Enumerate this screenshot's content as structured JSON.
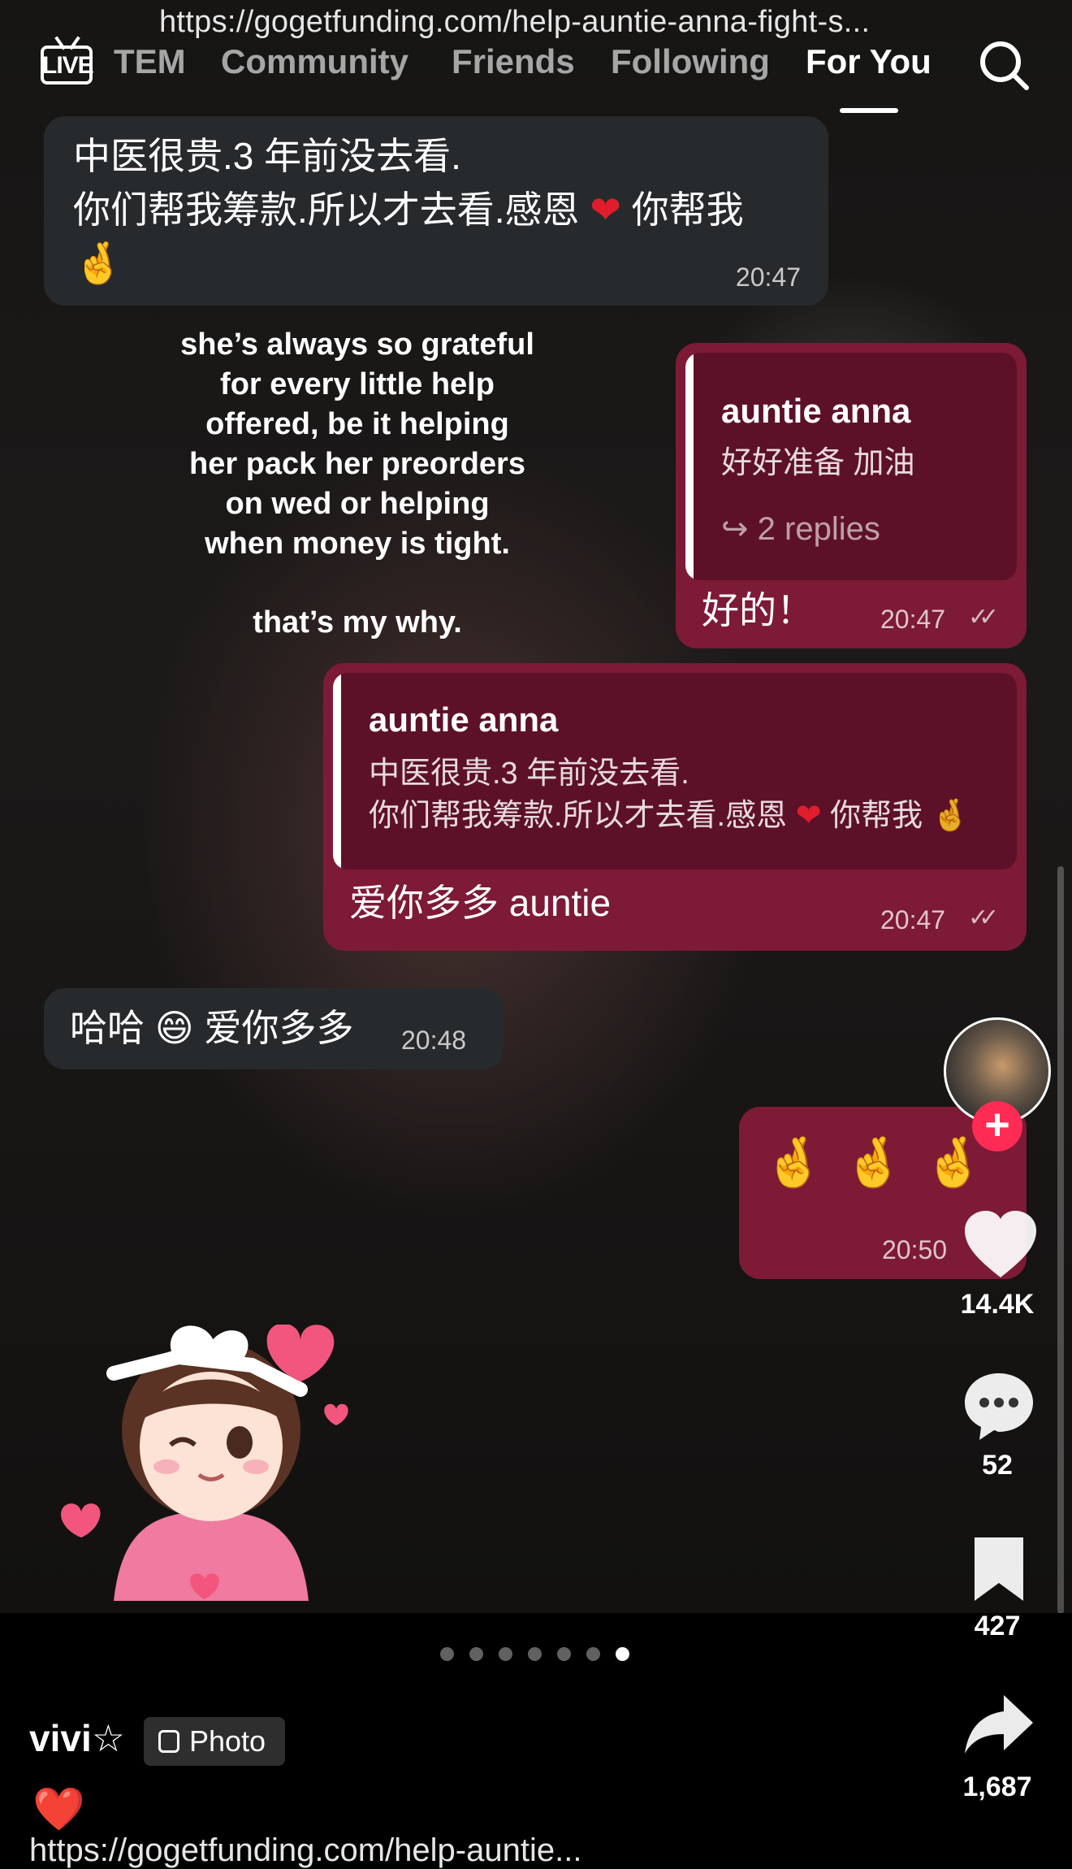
{
  "top_nav": {
    "url_text": "https://gogetfunding.com/help-auntie-anna-fight-s...",
    "live_label": "LIVE",
    "tabs": [
      "TEM",
      "Community",
      "Friends",
      "Following",
      "For You"
    ],
    "active_tab": "For You"
  },
  "chat": {
    "msg1": {
      "line1": "中医很贵.3 年前没去看.",
      "line2": "你们帮我筹款.所以才去看.感恩",
      "line2b": "你帮我",
      "time": "20:47"
    },
    "msg2": {
      "reply_name": "auntie anna",
      "reply_text": "好好准备  加油",
      "replies": "2 replies",
      "text": "好的！",
      "time": "20:47"
    },
    "msg3": {
      "reply_name": "auntie anna",
      "reply_line1": "中医很贵.3 年前没去看.",
      "reply_line2": "你们帮我筹款.所以才去看.感恩",
      "reply_line2b": "你帮我",
      "text": "爱你多多 auntie",
      "time": "20:47"
    },
    "msg4": {
      "text_a": "哈哈",
      "text_b": "爱你多多",
      "time": "20:48"
    },
    "msg5": {
      "time": "20:50"
    }
  },
  "caption": {
    "lines": [
      "she’s always so grateful",
      "for every little help",
      "offered, be it helping",
      "her pack her preorders",
      "on wed or helping",
      "when money is tight."
    ],
    "closing": "that’s my why."
  },
  "actions": {
    "likes": "14.4K",
    "comments": "52",
    "saves": "427",
    "shares": "1,687"
  },
  "carousel": {
    "count": 7,
    "active_index": 6
  },
  "post": {
    "author": "vivi☆",
    "badge": "Photo",
    "description_emoji": "❤️",
    "link_text": "https://gogetfunding.com/help-auntie..."
  },
  "colors": {
    "incoming": "#272a2c",
    "outgoing": "#7d1a36",
    "reply_box": "#5d1128",
    "follow": "#fe2c55"
  }
}
